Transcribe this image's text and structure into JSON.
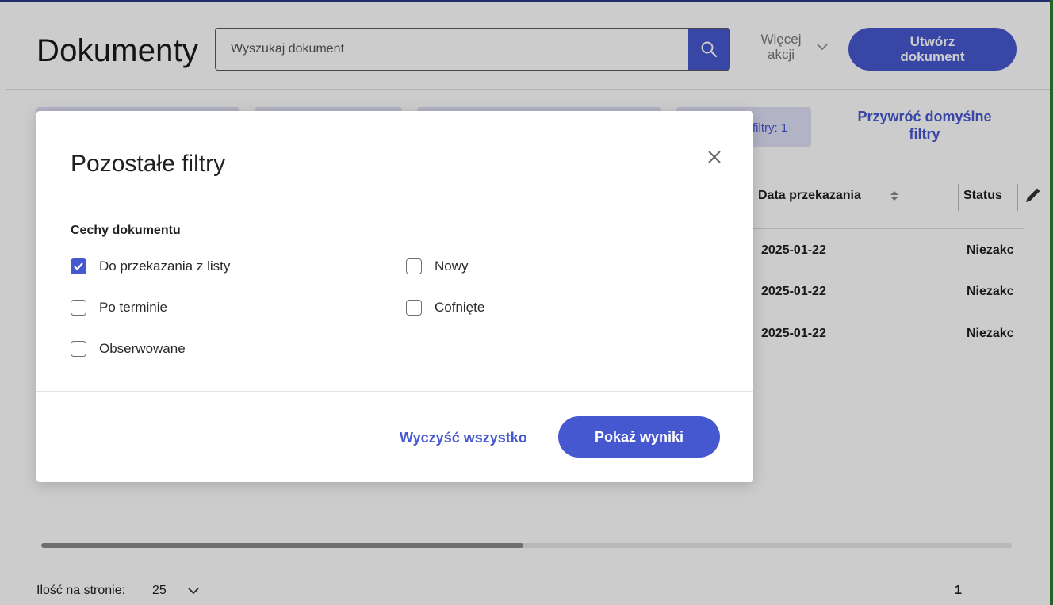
{
  "header": {
    "title": "Dokumenty",
    "search_placeholder": "Wyszukaj dokument",
    "more_actions_line1": "Więcej",
    "more_actions_line2": "akcji",
    "create_line1": "Utwórz",
    "create_line2": "dokument"
  },
  "filters": {
    "rest_label": "filtry: 1",
    "restore_line1": "Przywróć domyślne",
    "restore_line2": "filtry"
  },
  "table": {
    "col_date": "Data przekazania",
    "col_status": "Status",
    "rows": [
      {
        "date": "2025-01-22",
        "status": "Niezakc"
      },
      {
        "date": "2025-01-22",
        "status": "Niezakc"
      },
      {
        "date": "2025-01-22",
        "status": "Niezakc"
      }
    ]
  },
  "pager": {
    "label": "Ilość na stronie:",
    "page_size": "25",
    "current_page": "1",
    "scroll_position_fraction": 0.5
  },
  "modal": {
    "title": "Pozostałe filtry",
    "section": "Cechy dokumentu",
    "options": [
      {
        "label": "Do przekazania z listy",
        "checked": true
      },
      {
        "label": "Nowy",
        "checked": false
      },
      {
        "label": "Po terminie",
        "checked": false
      },
      {
        "label": "Cofnięte",
        "checked": false
      },
      {
        "label": "Obserwowane",
        "checked": false
      }
    ],
    "clear_label": "Wyczyść wszystko",
    "show_label": "Pokaż wyniki"
  },
  "colors": {
    "accent": "#4658d0",
    "chip_bg": "#dfe0f7",
    "edge_green": "#2e7d32",
    "overlay": "rgba(0,0,0,0.20)"
  },
  "icons": [
    "search-icon",
    "chevron-down-icon",
    "sort-icon",
    "pencil-icon",
    "close-icon",
    "checkmark-icon"
  ]
}
